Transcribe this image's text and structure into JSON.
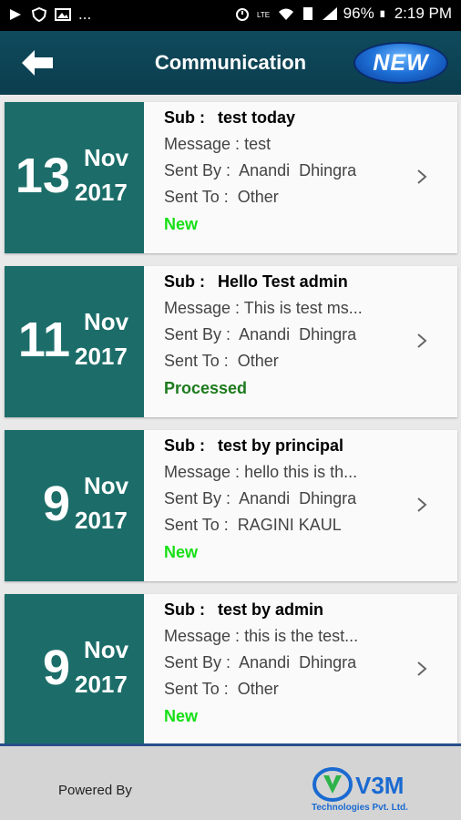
{
  "status_bar": {
    "battery": "96%",
    "time": "2:19 PM",
    "left_icons": [
      "play-icon",
      "shield-icon",
      "image-icon"
    ],
    "overflow": "..."
  },
  "header": {
    "title": "Communication",
    "new_label": "NEW",
    "back_icon": "back-arrow-icon",
    "color": "#0f4a5c"
  },
  "list": {
    "date_bg_color": "#1c6d69",
    "sub_label": "Sub :",
    "message_label": "Message :",
    "sent_by_label": "Sent By :",
    "sent_to_label": "Sent To :",
    "items": [
      {
        "day": "13",
        "month": "Nov",
        "year": "2017",
        "subject": "test today",
        "message": "test",
        "sent_by": "Anandi  Dhingra",
        "sent_to": "Other",
        "status": "New"
      },
      {
        "day": "11",
        "month": "Nov",
        "year": "2017",
        "subject": "Hello Test admin",
        "message": "This is test ms...",
        "sent_by": "Anandi  Dhingra",
        "sent_to": "Other",
        "status": "Processed"
      },
      {
        "day": "9",
        "month": "Nov",
        "year": "2017",
        "subject": "test by principal",
        "message": "hello this is th...",
        "sent_by": "Anandi  Dhingra",
        "sent_to": "RAGINI KAUL",
        "status": "New"
      },
      {
        "day": "9",
        "month": "Nov",
        "year": "2017",
        "subject": "test by admin",
        "message": "this is the test...",
        "sent_by": "Anandi  Dhingra",
        "sent_to": "Other",
        "status": "New"
      }
    ]
  },
  "footer": {
    "powered_by": "Powered By",
    "logo_text": "V3M",
    "logo_sub": "Technologies Pvt. Ltd."
  }
}
